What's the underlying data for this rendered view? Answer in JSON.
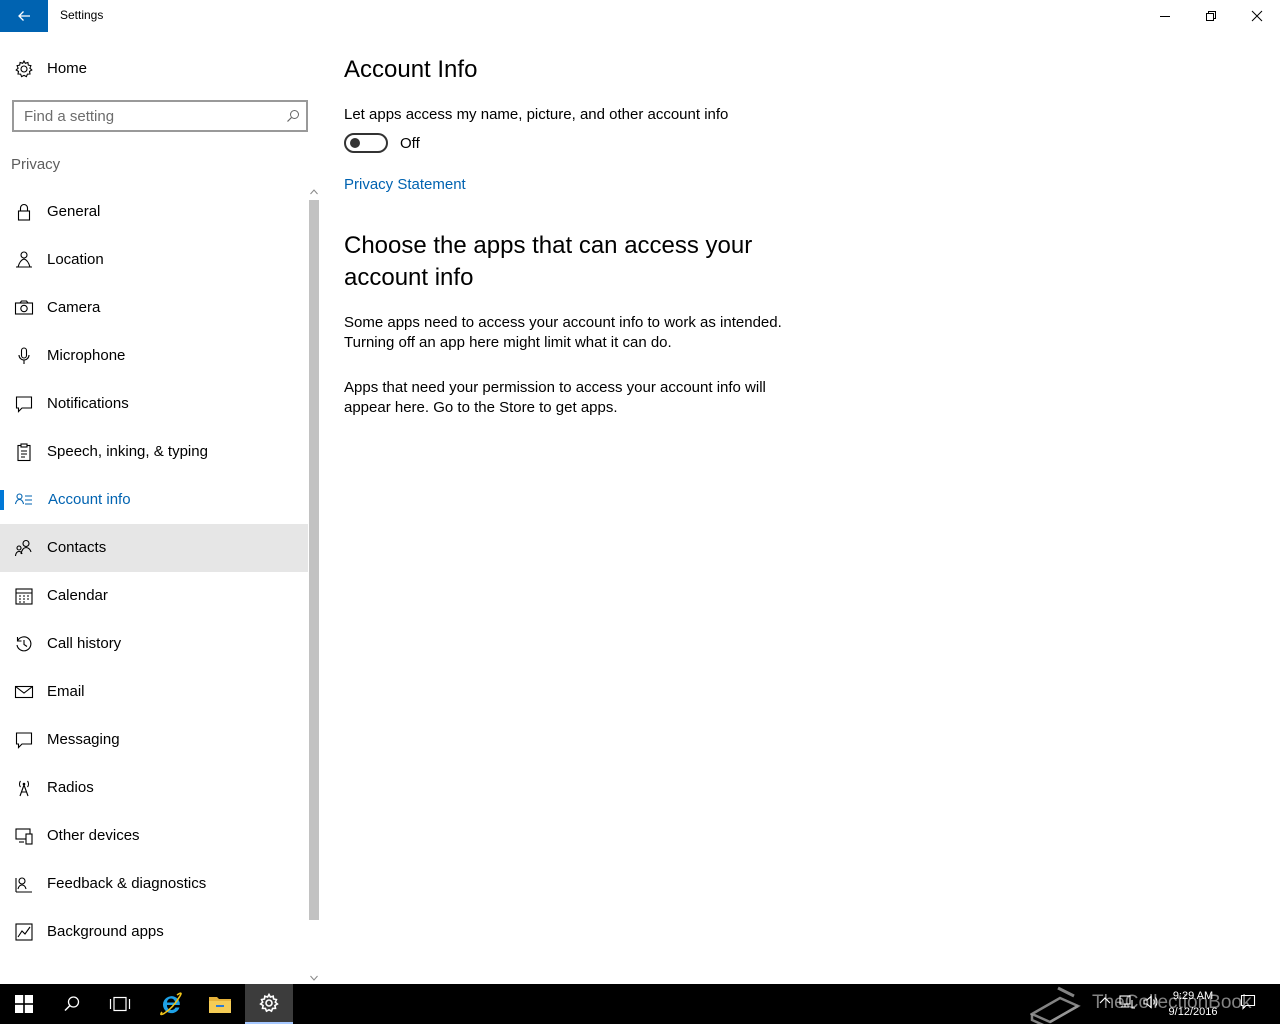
{
  "window": {
    "title": "Settings"
  },
  "sidebar": {
    "home_label": "Home",
    "search_placeholder": "Find a setting",
    "section_label": "Privacy",
    "items": [
      {
        "label": "General",
        "icon": "lock-icon"
      },
      {
        "label": "Location",
        "icon": "location-person-icon"
      },
      {
        "label": "Camera",
        "icon": "camera-icon"
      },
      {
        "label": "Microphone",
        "icon": "microphone-icon"
      },
      {
        "label": "Notifications",
        "icon": "notification-icon"
      },
      {
        "label": "Speech, inking, & typing",
        "icon": "clipboard-icon"
      },
      {
        "label": "Account info",
        "icon": "account-card-icon",
        "selected": true
      },
      {
        "label": "Contacts",
        "icon": "contacts-icon",
        "hover": true
      },
      {
        "label": "Calendar",
        "icon": "calendar-icon"
      },
      {
        "label": "Call history",
        "icon": "history-icon"
      },
      {
        "label": "Email",
        "icon": "email-icon"
      },
      {
        "label": "Messaging",
        "icon": "message-icon"
      },
      {
        "label": "Radios",
        "icon": "radio-tower-icon"
      },
      {
        "label": "Other devices",
        "icon": "devices-icon"
      },
      {
        "label": "Feedback & diagnostics",
        "icon": "feedback-icon"
      },
      {
        "label": "Background apps",
        "icon": "background-apps-icon"
      }
    ]
  },
  "main": {
    "title": "Account Info",
    "toggle_description": "Let apps access my name, picture, and other account info",
    "toggle_state": "Off",
    "toggle_on": false,
    "privacy_link": "Privacy Statement",
    "subheading": "Choose the apps that can access your account info",
    "paragraph1": "Some apps need to access your account info to work as intended. Turning off an app here might limit what it can do.",
    "paragraph2": "Apps that need your permission to access your account info will appear here. Go to the Store to get apps."
  },
  "taskbar": {
    "time": "9:29 AM",
    "date": "9/12/2016",
    "watermark": "TheCollectionBook"
  },
  "colors": {
    "accent": "#0063b1",
    "selected_indicator": "#0078d7",
    "hover_bg": "#e6e6e6",
    "taskbar_bg": "#000000"
  }
}
